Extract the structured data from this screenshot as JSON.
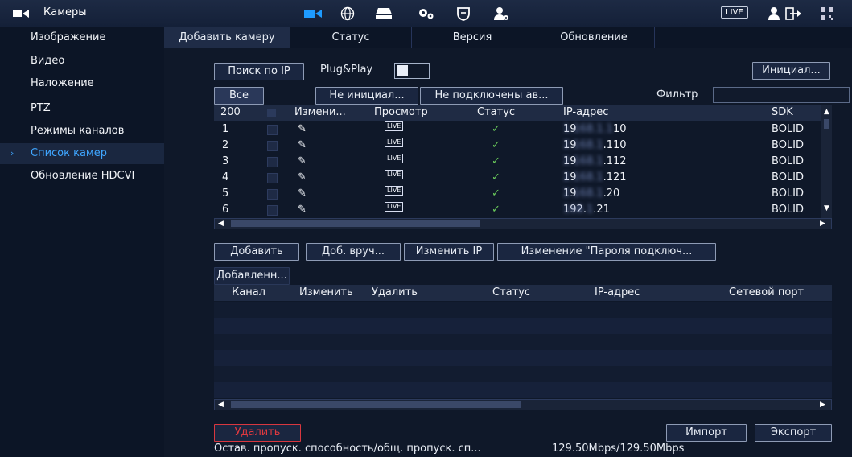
{
  "app": {
    "title": "Камеры",
    "live_badge": "LIVE"
  },
  "sidebar": {
    "items": [
      {
        "label": "Изображение"
      },
      {
        "label": "Видео"
      },
      {
        "label": "Наложение"
      },
      {
        "label": "PTZ"
      },
      {
        "label": "Режимы каналов"
      },
      {
        "label": "Список камер"
      },
      {
        "label": "Обновление HDCVI"
      }
    ],
    "active_index": 5
  },
  "tabs": [
    {
      "label": "Добавить камеру"
    },
    {
      "label": "Статус"
    },
    {
      "label": "Версия"
    },
    {
      "label": "Обновление"
    }
  ],
  "toolbar": {
    "search_ip": "Поиск по IP",
    "plug_play": "Plug&Play",
    "init_button": "Инициал...",
    "filter_label": "Фильтр",
    "filter_value": ""
  },
  "filters": {
    "all": "Все",
    "uninit": "Не инициал...",
    "not_connected": "Не подключены ав..."
  },
  "device_table": {
    "headers": {
      "count": "200",
      "edit": "Измени...",
      "preview": "Просмотр",
      "status": "Статус",
      "ip": "IP-адрес",
      "sdk": "SDK"
    },
    "rows": [
      {
        "n": "1",
        "ip_visible": "19",
        "ip_suffix": "10",
        "sdk": "BOLID"
      },
      {
        "n": "2",
        "ip_visible": "19",
        "ip_suffix": ".110",
        "sdk": "BOLID"
      },
      {
        "n": "3",
        "ip_visible": "19",
        "ip_suffix": ".112",
        "sdk": "BOLID"
      },
      {
        "n": "4",
        "ip_visible": "19",
        "ip_suffix": ".121",
        "sdk": "BOLID"
      },
      {
        "n": "5",
        "ip_visible": "19",
        "ip_suffix": ".20",
        "sdk": "BOLID"
      },
      {
        "n": "6",
        "ip_visible": "192.",
        "ip_suffix": ".21",
        "sdk": "BOLID"
      }
    ],
    "live_label": "LIVE"
  },
  "actions": {
    "add": "Добавить",
    "manual": "Доб. вруч...",
    "change_ip": "Изменить IP",
    "change_pwd": "Изменение \"Пароля подключ..."
  },
  "added": {
    "section": "Добавленн...",
    "headers": {
      "channel": "Канал",
      "edit": "Изменить",
      "delete": "Удалить",
      "status": "Статус",
      "ip": "IP-адрес",
      "port": "Сетевой порт"
    }
  },
  "bottom": {
    "delete": "Удалить",
    "import": "Импорт",
    "export": "Экспорт",
    "bandwidth_label": "Остав. пропуск. способность/общ. пропуск. сп...",
    "bandwidth_value": "129.50Mbps/129.50Mbps"
  },
  "colors": {
    "accent": "#3fa6ff",
    "danger": "#e0393f",
    "background": "#0b1322"
  }
}
